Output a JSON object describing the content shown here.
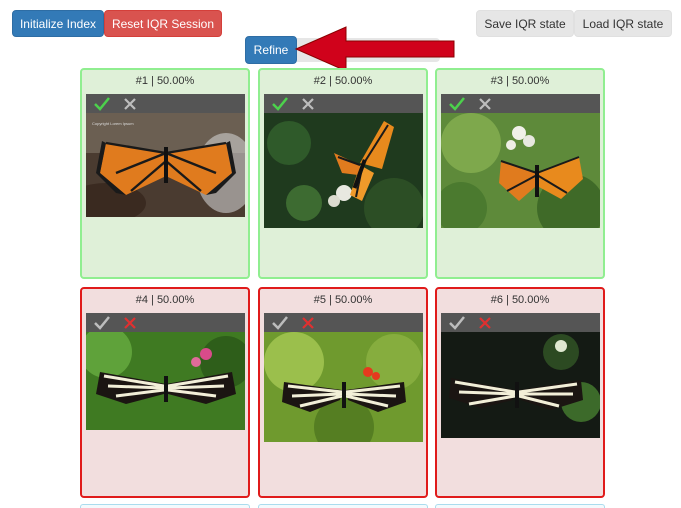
{
  "toolbar": {
    "init_label": "Initialize Index",
    "reset_label": "Reset IQR Session",
    "save_label": "Save IQR state",
    "load_label": "Load IQR state",
    "refine_label": "Refine"
  },
  "results": [
    {
      "title": "#1 | 50.00%",
      "status": "positive",
      "image": "monarch butterfly",
      "caption": "Copyright Lorem Ipsum"
    },
    {
      "title": "#2 | 50.00%",
      "status": "positive",
      "image": "monarch butterfly"
    },
    {
      "title": "#3 | 50.00%",
      "status": "positive",
      "image": "monarch butterfly"
    },
    {
      "title": "#4 | 50.00%",
      "status": "negative",
      "image": "zebra longwing butterfly"
    },
    {
      "title": "#5 | 50.00%",
      "status": "negative",
      "image": "zebra longwing butterfly"
    },
    {
      "title": "#6 | 50.00%",
      "status": "negative",
      "image": "zebra longwing butterfly"
    }
  ],
  "icons": {
    "positive": "check-icon",
    "negative": "cross-icon"
  },
  "colors": {
    "primary": "#337ab7",
    "danger": "#d9534f",
    "positive_bg": "#dff0d8",
    "positive_border": "#90ee90",
    "negative_bg": "#f2dede",
    "negative_border": "#e01b1b",
    "check": "#4cd14c",
    "cross": "#e03030",
    "arrow": "#d0021b"
  }
}
